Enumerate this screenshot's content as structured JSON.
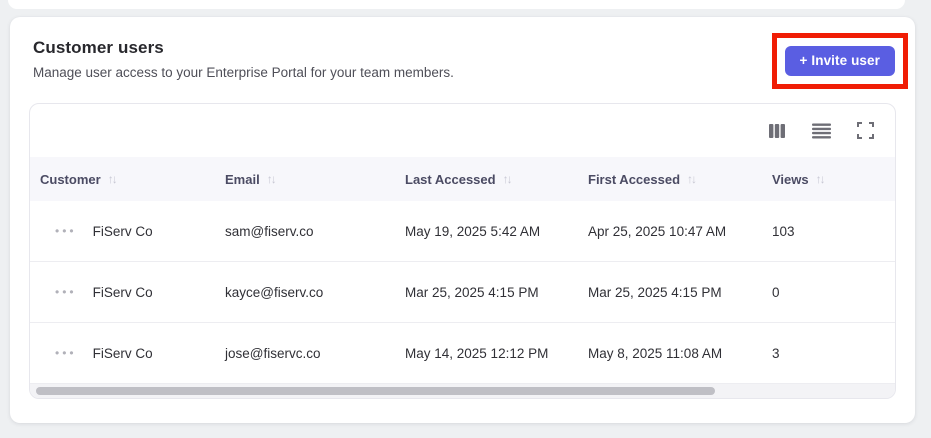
{
  "card": {
    "title": "Customer users",
    "subtitle": "Manage user access to your Enterprise Portal for your team members.",
    "invite_button_label": "+ Invite user"
  },
  "toolbar": {
    "icons": [
      "columns-icon",
      "row-density-icon",
      "fullscreen-icon"
    ]
  },
  "table": {
    "columns": [
      "Customer",
      "Email",
      "Last Accessed",
      "First Accessed",
      "Views"
    ],
    "rows": [
      {
        "customer": "FiServ Co",
        "email": "sam@fiserv.co",
        "last_accessed": "May 19, 2025 5:42 AM",
        "first_accessed": "Apr 25, 2025 10:47 AM",
        "views": "103"
      },
      {
        "customer": "FiServ Co",
        "email": "kayce@fiserv.co",
        "last_accessed": "Mar 25, 2025 4:15 PM",
        "first_accessed": "Mar 25, 2025 4:15 PM",
        "views": "0"
      },
      {
        "customer": "FiServ Co",
        "email": "jose@fiservc.co",
        "last_accessed": "May 14, 2025 12:12 PM",
        "first_accessed": "May 8, 2025 11:08 AM",
        "views": "3"
      }
    ]
  },
  "glyphs": {
    "sort": "↑↓",
    "row_menu": "•••"
  },
  "colors": {
    "accent": "#5a5ee2",
    "annotation_red": "#f01d05",
    "header_bg": "#f7f7fb",
    "page_bg": "#eef0f2"
  }
}
